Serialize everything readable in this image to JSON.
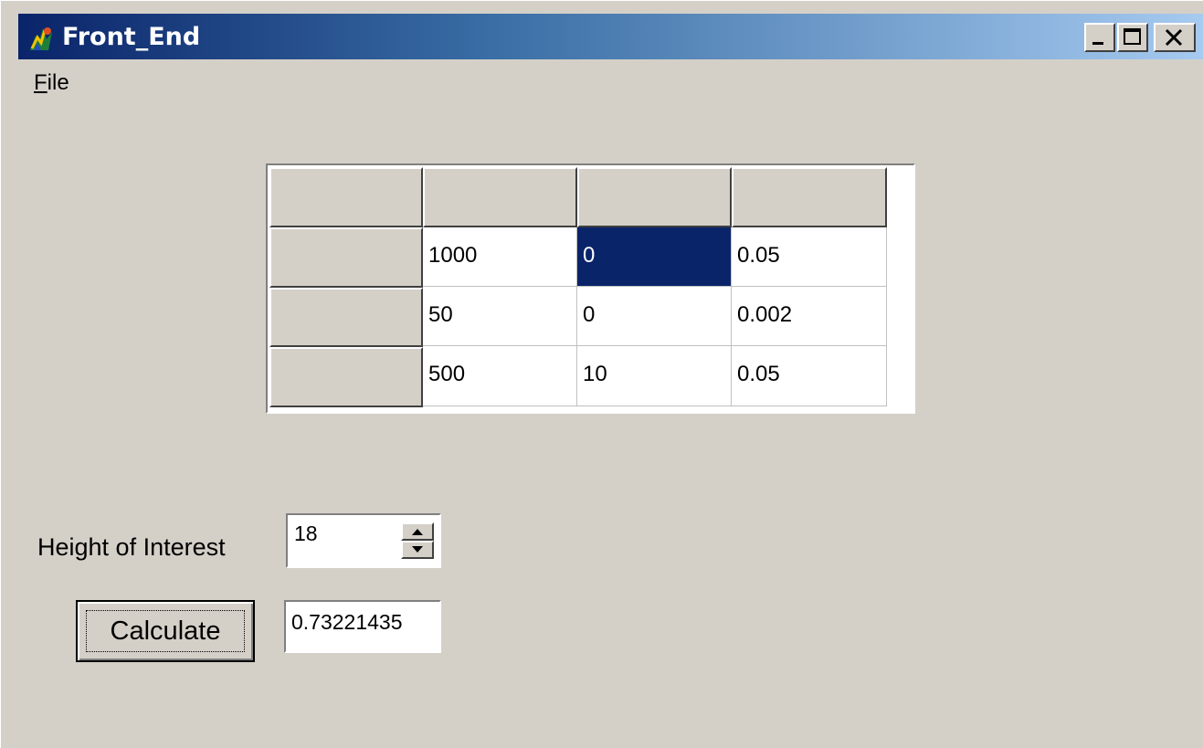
{
  "window": {
    "title": "Front_End",
    "icon": "app-icon",
    "caption_buttons": [
      "minimize-icon",
      "maximize-icon",
      "close-icon"
    ],
    "titlebar_colors": [
      "#0a246a",
      "#a6caf0"
    ]
  },
  "menu": {
    "items": [
      {
        "label_first": "F",
        "label_rest": "ile"
      }
    ]
  },
  "grid": {
    "header": [
      "",
      "",
      "",
      ""
    ],
    "rows": [
      {
        "header": "",
        "cells": [
          "1000",
          "0",
          "0.05"
        ]
      },
      {
        "header": "",
        "cells": [
          "50",
          "0",
          "0.002"
        ]
      },
      {
        "header": "",
        "cells": [
          "500",
          "10",
          "0.05"
        ]
      }
    ],
    "selected_color": "#0a246a"
  },
  "controls": {
    "height_label": "Height of Interest",
    "height_value": "18",
    "calculate_label": "Calculate",
    "result_value": "0.73221435"
  }
}
